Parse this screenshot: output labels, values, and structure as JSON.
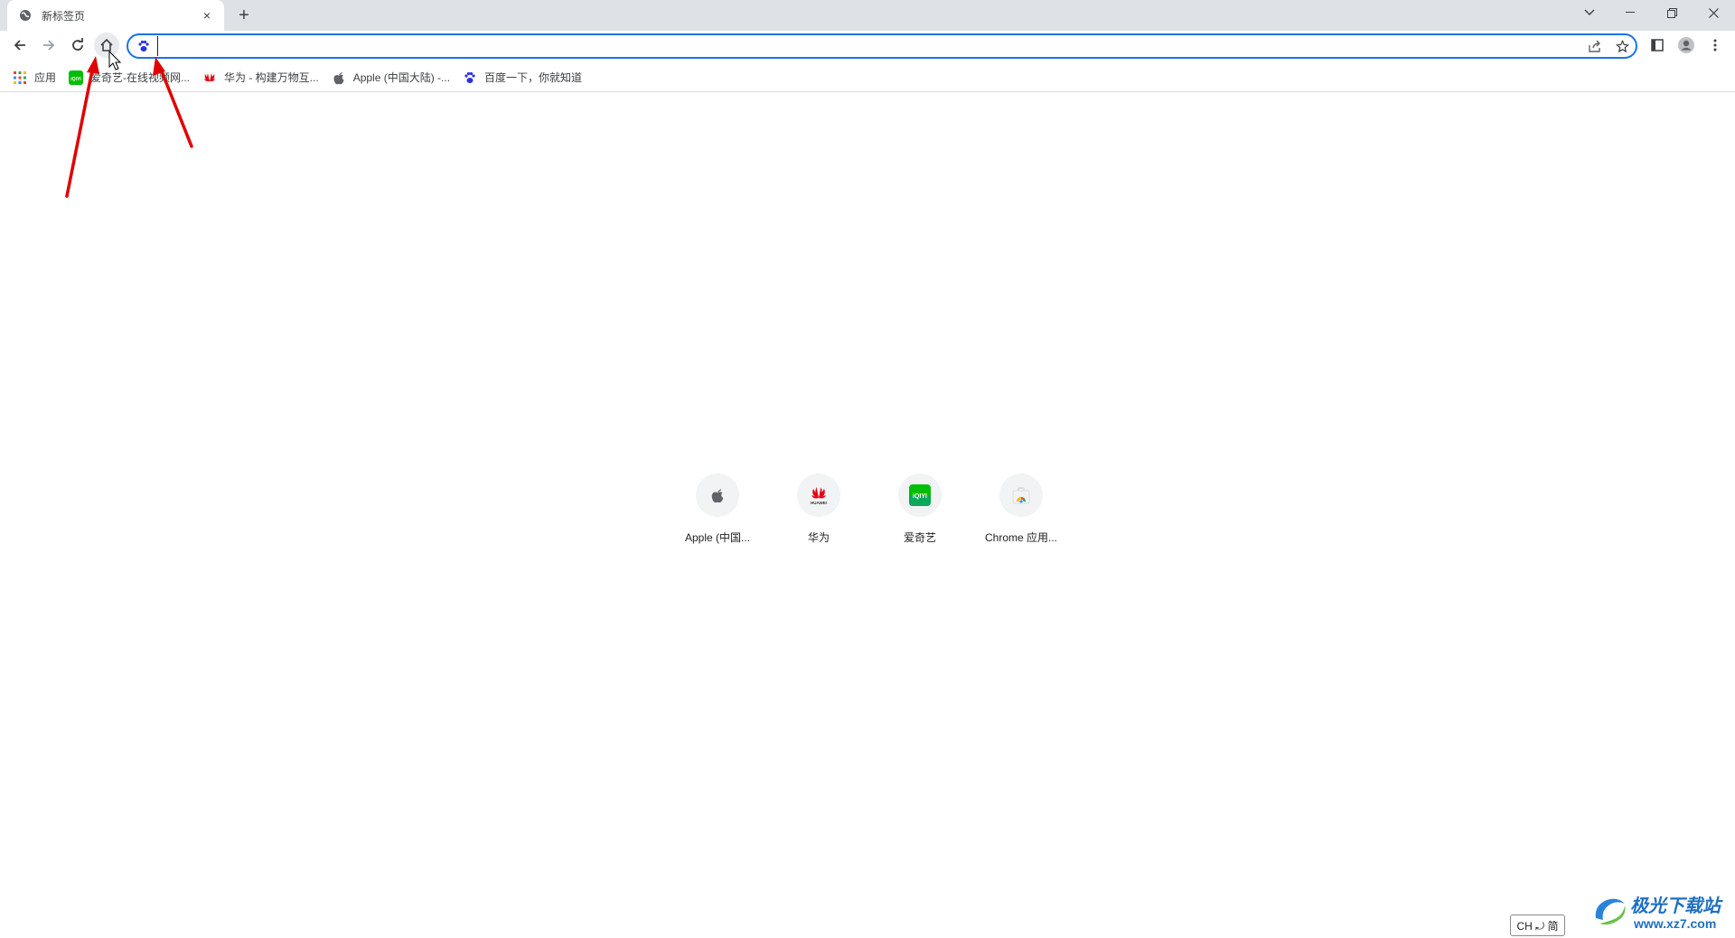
{
  "tab": {
    "title": "新标签页",
    "close": "×"
  },
  "newtab": "+",
  "omnibox": {
    "value": ""
  },
  "bookmarks": [
    {
      "label": "应用",
      "icon": "apps-grid-icon"
    },
    {
      "label": "爱奇艺-在线视频网...",
      "icon": "iqiyi-icon"
    },
    {
      "label": "华为 - 构建万物互...",
      "icon": "huawei-icon"
    },
    {
      "label": "Apple (中国大陆) -...",
      "icon": "apple-icon"
    },
    {
      "label": "百度一下，你就知道",
      "icon": "baidu-icon"
    }
  ],
  "shortcuts": [
    {
      "label": "Apple (中国...",
      "icon": "apple-icon"
    },
    {
      "label": "华为",
      "icon": "huawei-icon"
    },
    {
      "label": "爱奇艺",
      "icon": "iqiyi-icon"
    },
    {
      "label": "Chrome 应用...",
      "icon": "chrome-web-store-icon"
    }
  ],
  "ime": "CH ⤾ 简",
  "watermark": {
    "title": "极光下载站",
    "url": "www.xz7.com"
  },
  "colors": {
    "accent": "#1a73e8",
    "annotation": "#e00000",
    "tabstrip": "#dee1e6"
  }
}
